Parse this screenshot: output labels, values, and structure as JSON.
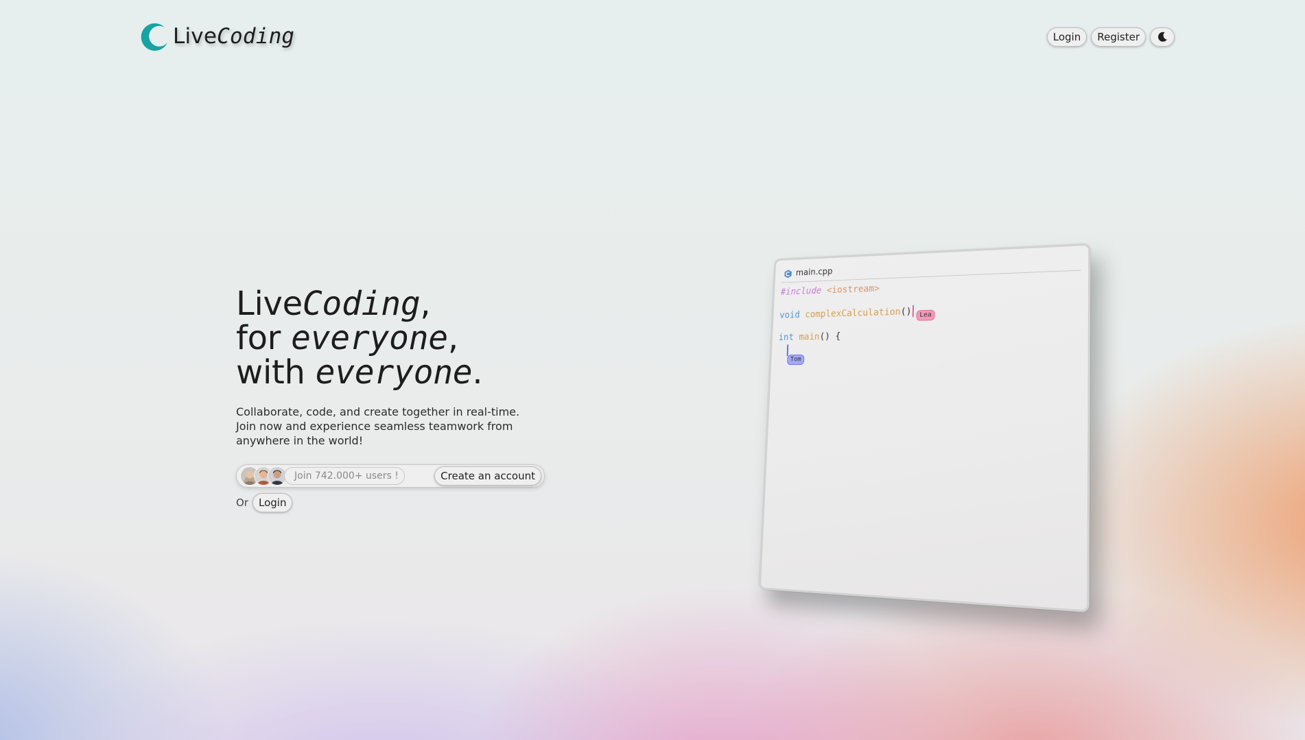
{
  "brand": {
    "name_live": "Live",
    "name_coding": "Coding",
    "logo_color": "#17a3a3"
  },
  "nav": {
    "login_label": "Login",
    "register_label": "Register",
    "theme_toggle_icon": "moon-icon"
  },
  "hero": {
    "line1_a": "Live",
    "line1_b": "Coding",
    "line1_c": ",",
    "line2_a": "for ",
    "line2_b": "everyone",
    "line2_c": ",",
    "line3_a": "with ",
    "line3_b": "everyone",
    "line3_c": ".",
    "description": "Collaborate, code, and create together in real-time. Join now and experience seamless teamwork from anywhere in the world!",
    "users_text": "Join 742.000+ users !",
    "create_account_label": "Create an account",
    "or_text": "Or",
    "login_label": "Login"
  },
  "editor": {
    "tab_name": "main.cpp",
    "tab_icon": "cpp-file-icon",
    "lines": {
      "l1_directive": "#include",
      "l1_header": " <iostream>",
      "l2_type": "void",
      "l2_fn": " complexCalculation",
      "l2_punct": "()",
      "l3_type": "int",
      "l3_fn": " main",
      "l3_punct": "() {"
    },
    "collaborators": {
      "lea": "Lea",
      "tom": "Tom"
    },
    "colors": {
      "lea": "#e8609a",
      "tom": "#5a63e0"
    }
  }
}
